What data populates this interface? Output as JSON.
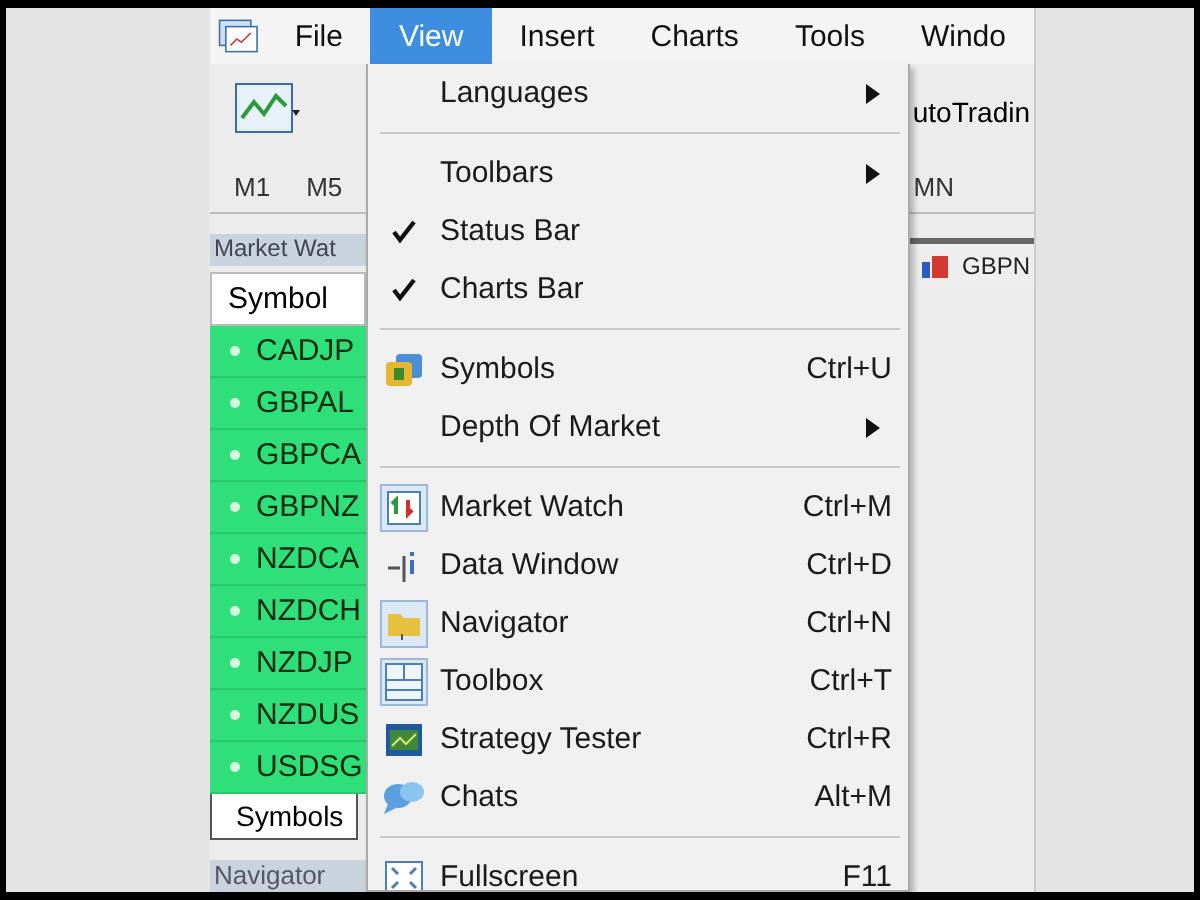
{
  "menu_bar": [
    {
      "label": "File",
      "selected": false
    },
    {
      "label": "View",
      "selected": true
    },
    {
      "label": "Insert",
      "selected": false
    },
    {
      "label": "Charts",
      "selected": false
    },
    {
      "label": "Tools",
      "selected": false
    },
    {
      "label": "Windo",
      "selected": false
    }
  ],
  "toolbar": {
    "auto_trading": "utoTradin"
  },
  "timeframes": [
    "M1",
    "M5",
    "MN"
  ],
  "market_watch": {
    "title": "Market Wat",
    "column": "Symbol",
    "rows": [
      "CADJP",
      "GBPAL",
      "GBPCA",
      "GBPNZ",
      "NZDCA",
      "NZDCH",
      "NZDJP",
      "NZDUS",
      "USDSG"
    ],
    "tab": "Symbols"
  },
  "navigator": {
    "title": "Navigator"
  },
  "chart_tab": "GBPN",
  "view_menu": [
    {
      "kind": "item",
      "label": "Languages",
      "submenu": true
    },
    {
      "kind": "separator"
    },
    {
      "kind": "item",
      "label": "Toolbars",
      "submenu": true
    },
    {
      "kind": "item",
      "label": "Status Bar",
      "checked": true
    },
    {
      "kind": "item",
      "label": "Charts Bar",
      "checked": true
    },
    {
      "kind": "separator"
    },
    {
      "kind": "item",
      "label": "Symbols",
      "shortcut": "Ctrl+U"
    },
    {
      "kind": "item",
      "label": "Depth Of Market",
      "submenu": true
    },
    {
      "kind": "separator"
    },
    {
      "kind": "item",
      "label": "Market Watch",
      "shortcut": "Ctrl+M",
      "checked": true
    },
    {
      "kind": "item",
      "label": "Data Window",
      "shortcut": "Ctrl+D",
      "checked": false
    },
    {
      "kind": "item",
      "label": "Navigator",
      "shortcut": "Ctrl+N",
      "checked": true
    },
    {
      "kind": "item",
      "label": "Toolbox",
      "shortcut": "Ctrl+T",
      "checked": true
    },
    {
      "kind": "item",
      "label": "Strategy Tester",
      "shortcut": "Ctrl+R",
      "checked": false
    },
    {
      "kind": "item",
      "label": "Chats",
      "shortcut": "Alt+M"
    },
    {
      "kind": "separator"
    },
    {
      "kind": "item",
      "label": "Fullscreen",
      "shortcut": "F11"
    }
  ]
}
